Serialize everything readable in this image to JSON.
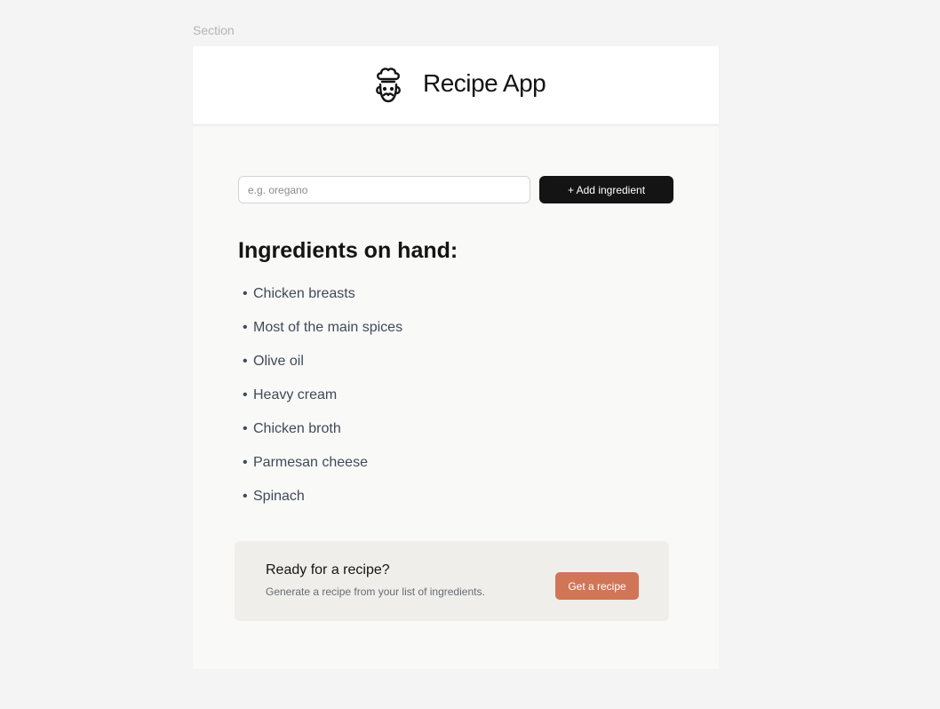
{
  "canvas": {
    "section_label": "Section"
  },
  "header": {
    "logo_icon": "chef-icon",
    "title": "Recipe App"
  },
  "add_form": {
    "input_placeholder": "e.g. oregano",
    "input_value": "",
    "add_button_label": "+ Add ingredient"
  },
  "ingredients": {
    "heading": "Ingredients on hand:",
    "items": [
      "Chicken breasts",
      "Most of the main spices",
      "Olive oil",
      "Heavy cream",
      "Chicken broth",
      "Parmesan cheese",
      "Spinach"
    ]
  },
  "cta": {
    "title": "Ready for a recipe?",
    "subtitle": "Generate a recipe from your list of ingredients.",
    "button_label": "Get a recipe"
  },
  "colors": {
    "primary_button": "#141414",
    "accent_button": "#d17557",
    "cta_background": "#efeeea",
    "text_muted": "#3f4a5a"
  }
}
